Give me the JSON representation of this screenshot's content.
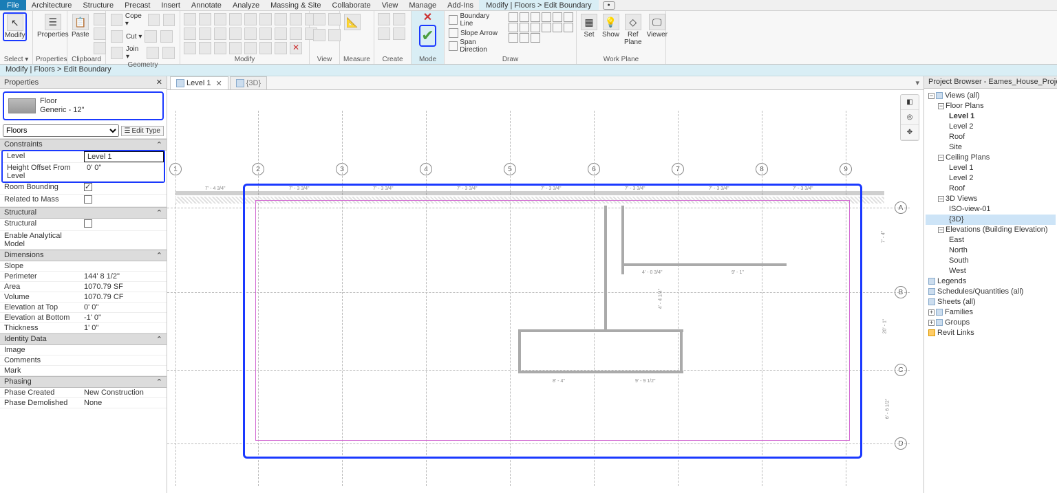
{
  "menu": {
    "file": "File",
    "items": [
      "Architecture",
      "Structure",
      "Precast",
      "Insert",
      "Annotate",
      "Analyze",
      "Massing & Site",
      "Collaborate",
      "View",
      "Manage",
      "Add-Ins"
    ],
    "modify_tab": "Modify | Floors > Edit Boundary"
  },
  "ribbon": {
    "select": {
      "modify": "Modify",
      "title": "Select ▾"
    },
    "properties": {
      "label": "Properties",
      "title": "Properties"
    },
    "clipboard": {
      "paste": "Paste",
      "title": "Clipboard",
      "cope": "Cope ▾",
      "cut": "Cut ▾",
      "join": "Join ▾"
    },
    "geometry": {
      "title": "Geometry"
    },
    "modify": {
      "title": "Modify"
    },
    "view": {
      "title": "View"
    },
    "measure": {
      "title": "Measure"
    },
    "create": {
      "title": "Create"
    },
    "mode": {
      "title": "Mode"
    },
    "draw": {
      "title": "Draw",
      "bl": "Boundary Line",
      "sa": "Slope Arrow",
      "sd": "Span Direction"
    },
    "workplane": {
      "set": "Set",
      "show": "Show",
      "refplane": "Ref\nPlane",
      "viewer": "Viewer",
      "title": "Work Plane"
    }
  },
  "breadcrumb": "Modify | Floors > Edit Boundary",
  "properties": {
    "title": "Properties",
    "type_family": "Floor",
    "type_name": "Generic - 12\"",
    "filter": "Floors",
    "edit_type": "Edit Type",
    "groups": {
      "constraints": "Constraints",
      "structural": "Structural",
      "dimensions": "Dimensions",
      "identity": "Identity Data",
      "phasing": "Phasing"
    },
    "rows": {
      "level_k": "Level",
      "level_v": "Level 1",
      "ho_k": "Height Offset From Level",
      "ho_v": "0'  0\"",
      "rb_k": "Room Bounding",
      "rm_k": "Related to Mass",
      "struct_k": "Structural",
      "eam_k": "Enable Analytical Model",
      "slope_k": "Slope",
      "slope_v": "",
      "perim_k": "Perimeter",
      "perim_v": "144'  8 1/2\"",
      "area_k": "Area",
      "area_v": "1070.79 SF",
      "vol_k": "Volume",
      "vol_v": "1070.79 CF",
      "et_k": "Elevation at Top",
      "et_v": "0'  0\"",
      "eb_k": "Elevation at Bottom",
      "eb_v": "-1'  0\"",
      "thk_k": "Thickness",
      "thk_v": "1'  0\"",
      "img_k": "Image",
      "img_v": "",
      "cmt_k": "Comments",
      "cmt_v": "",
      "mrk_k": "Mark",
      "mrk_v": "",
      "pc_k": "Phase Created",
      "pc_v": "New Construction",
      "pd_k": "Phase Demolished",
      "pd_v": "None"
    }
  },
  "tabs": {
    "t1": "Level 1",
    "t2": "{3D}"
  },
  "grids": {
    "dims_h": [
      "7' - 4 3/4\"",
      "7' - 3 3/4\"",
      "7' - 3 3/4\"",
      "7' - 3 3/4\"",
      "7' - 3 3/4\"",
      "7' - 3 3/4\"",
      "7' - 3 3/4\"",
      "7' - 3 3/4\""
    ],
    "dims_interior": [
      "4' - 0 3/4\"",
      "9' - 1\"",
      "8' - 4\"",
      "9' - 9 1/2\"",
      "4' - 4 1/4\"",
      "7' - 4\"",
      "20' - 1\"",
      "6' - 6 1/2\""
    ]
  },
  "browser": {
    "title": "Project Browser - Eames_House_Project...",
    "views": "Views (all)",
    "fp": "Floor Plans",
    "fp1": "Level 1",
    "fp2": "Level 2",
    "fp3": "Roof",
    "fp4": "Site",
    "cp": "Ceiling Plans",
    "cp1": "Level 1",
    "cp2": "Level 2",
    "cp3": "Roof",
    "v3d": "3D Views",
    "v3d1": "ISO-view-01",
    "v3d2": "{3D}",
    "elev": "Elevations (Building Elevation)",
    "e1": "East",
    "e2": "North",
    "e3": "South",
    "e4": "West",
    "leg": "Legends",
    "sq": "Schedules/Quantities (all)",
    "sh": "Sheets (all)",
    "fam": "Families",
    "grp": "Groups",
    "rl": "Revit Links"
  }
}
